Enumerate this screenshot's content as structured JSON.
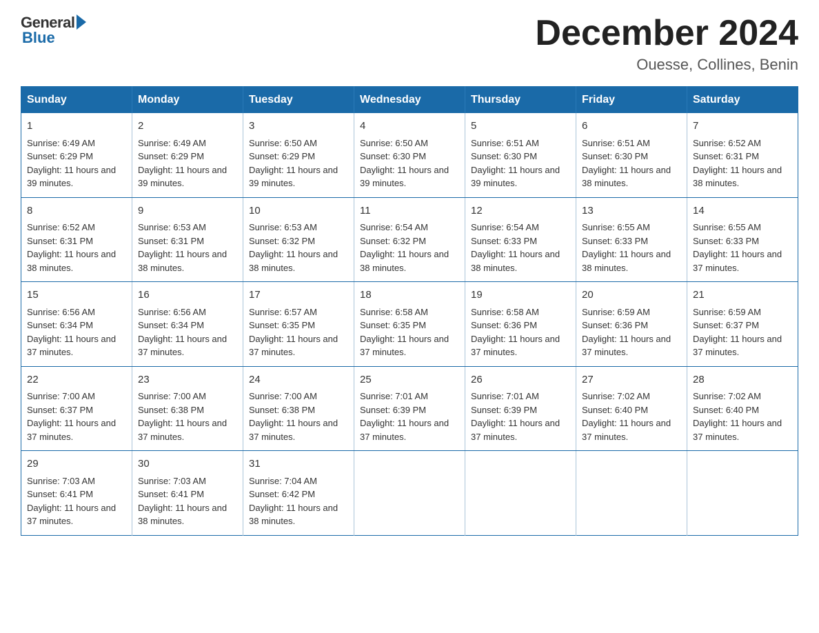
{
  "logo": {
    "general": "General",
    "blue": "Blue"
  },
  "title": "December 2024",
  "location": "Ouesse, Collines, Benin",
  "days_of_week": [
    "Sunday",
    "Monday",
    "Tuesday",
    "Wednesday",
    "Thursday",
    "Friday",
    "Saturday"
  ],
  "weeks": [
    [
      {
        "day": 1,
        "sunrise": "6:49 AM",
        "sunset": "6:29 PM",
        "daylight": "11 hours and 39 minutes."
      },
      {
        "day": 2,
        "sunrise": "6:49 AM",
        "sunset": "6:29 PM",
        "daylight": "11 hours and 39 minutes."
      },
      {
        "day": 3,
        "sunrise": "6:50 AM",
        "sunset": "6:29 PM",
        "daylight": "11 hours and 39 minutes."
      },
      {
        "day": 4,
        "sunrise": "6:50 AM",
        "sunset": "6:30 PM",
        "daylight": "11 hours and 39 minutes."
      },
      {
        "day": 5,
        "sunrise": "6:51 AM",
        "sunset": "6:30 PM",
        "daylight": "11 hours and 39 minutes."
      },
      {
        "day": 6,
        "sunrise": "6:51 AM",
        "sunset": "6:30 PM",
        "daylight": "11 hours and 38 minutes."
      },
      {
        "day": 7,
        "sunrise": "6:52 AM",
        "sunset": "6:31 PM",
        "daylight": "11 hours and 38 minutes."
      }
    ],
    [
      {
        "day": 8,
        "sunrise": "6:52 AM",
        "sunset": "6:31 PM",
        "daylight": "11 hours and 38 minutes."
      },
      {
        "day": 9,
        "sunrise": "6:53 AM",
        "sunset": "6:31 PM",
        "daylight": "11 hours and 38 minutes."
      },
      {
        "day": 10,
        "sunrise": "6:53 AM",
        "sunset": "6:32 PM",
        "daylight": "11 hours and 38 minutes."
      },
      {
        "day": 11,
        "sunrise": "6:54 AM",
        "sunset": "6:32 PM",
        "daylight": "11 hours and 38 minutes."
      },
      {
        "day": 12,
        "sunrise": "6:54 AM",
        "sunset": "6:33 PM",
        "daylight": "11 hours and 38 minutes."
      },
      {
        "day": 13,
        "sunrise": "6:55 AM",
        "sunset": "6:33 PM",
        "daylight": "11 hours and 38 minutes."
      },
      {
        "day": 14,
        "sunrise": "6:55 AM",
        "sunset": "6:33 PM",
        "daylight": "11 hours and 37 minutes."
      }
    ],
    [
      {
        "day": 15,
        "sunrise": "6:56 AM",
        "sunset": "6:34 PM",
        "daylight": "11 hours and 37 minutes."
      },
      {
        "day": 16,
        "sunrise": "6:56 AM",
        "sunset": "6:34 PM",
        "daylight": "11 hours and 37 minutes."
      },
      {
        "day": 17,
        "sunrise": "6:57 AM",
        "sunset": "6:35 PM",
        "daylight": "11 hours and 37 minutes."
      },
      {
        "day": 18,
        "sunrise": "6:58 AM",
        "sunset": "6:35 PM",
        "daylight": "11 hours and 37 minutes."
      },
      {
        "day": 19,
        "sunrise": "6:58 AM",
        "sunset": "6:36 PM",
        "daylight": "11 hours and 37 minutes."
      },
      {
        "day": 20,
        "sunrise": "6:59 AM",
        "sunset": "6:36 PM",
        "daylight": "11 hours and 37 minutes."
      },
      {
        "day": 21,
        "sunrise": "6:59 AM",
        "sunset": "6:37 PM",
        "daylight": "11 hours and 37 minutes."
      }
    ],
    [
      {
        "day": 22,
        "sunrise": "7:00 AM",
        "sunset": "6:37 PM",
        "daylight": "11 hours and 37 minutes."
      },
      {
        "day": 23,
        "sunrise": "7:00 AM",
        "sunset": "6:38 PM",
        "daylight": "11 hours and 37 minutes."
      },
      {
        "day": 24,
        "sunrise": "7:00 AM",
        "sunset": "6:38 PM",
        "daylight": "11 hours and 37 minutes."
      },
      {
        "day": 25,
        "sunrise": "7:01 AM",
        "sunset": "6:39 PM",
        "daylight": "11 hours and 37 minutes."
      },
      {
        "day": 26,
        "sunrise": "7:01 AM",
        "sunset": "6:39 PM",
        "daylight": "11 hours and 37 minutes."
      },
      {
        "day": 27,
        "sunrise": "7:02 AM",
        "sunset": "6:40 PM",
        "daylight": "11 hours and 37 minutes."
      },
      {
        "day": 28,
        "sunrise": "7:02 AM",
        "sunset": "6:40 PM",
        "daylight": "11 hours and 37 minutes."
      }
    ],
    [
      {
        "day": 29,
        "sunrise": "7:03 AM",
        "sunset": "6:41 PM",
        "daylight": "11 hours and 37 minutes."
      },
      {
        "day": 30,
        "sunrise": "7:03 AM",
        "sunset": "6:41 PM",
        "daylight": "11 hours and 38 minutes."
      },
      {
        "day": 31,
        "sunrise": "7:04 AM",
        "sunset": "6:42 PM",
        "daylight": "11 hours and 38 minutes."
      },
      null,
      null,
      null,
      null
    ]
  ]
}
